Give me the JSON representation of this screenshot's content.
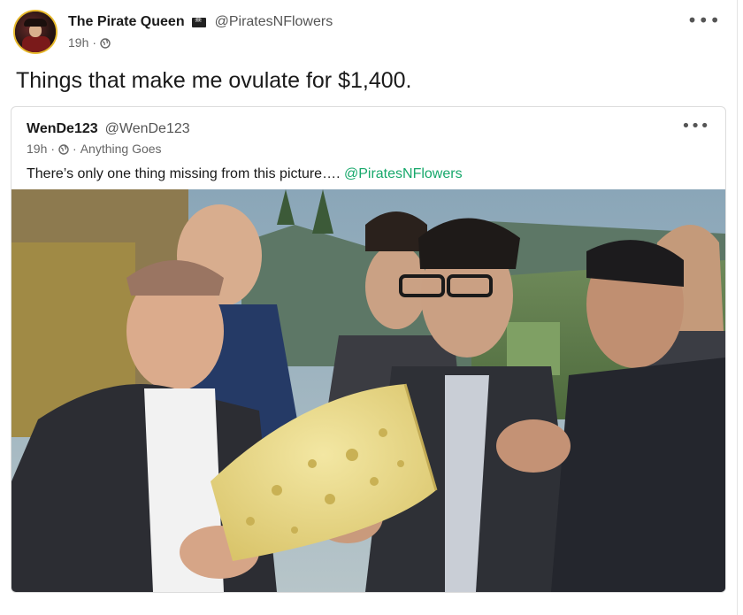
{
  "post": {
    "display_name": "The Pirate Queen",
    "handle": "@PiratesNFlowers",
    "time": "19h",
    "separator": "·",
    "text": "Things that make me ovulate for $1,400.",
    "more_label": "•••"
  },
  "quoted": {
    "display_name": "WenDe123",
    "handle": "@WenDe123",
    "time": "19h",
    "separator": "·",
    "separator2": "·",
    "community": "Anything Goes",
    "text": "There’s only one thing missing from this picture…. ",
    "mention": "@PiratesNFlowers",
    "more_label": "•••"
  },
  "icons": {
    "flag": "pirate-flag-icon",
    "globe": "globe-icon"
  },
  "colors": {
    "mention": "#17a86b",
    "avatar_ring": "#e7b92b"
  }
}
